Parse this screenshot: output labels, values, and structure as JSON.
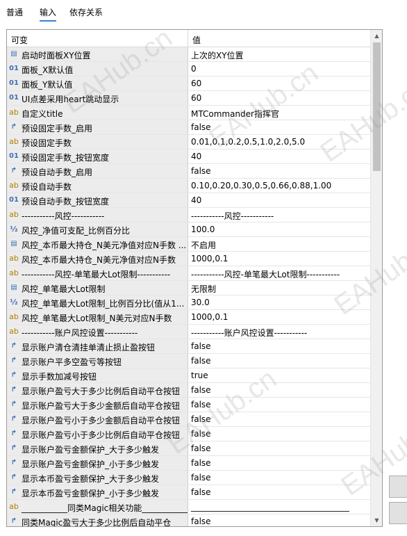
{
  "tabs": [
    {
      "label": "普通"
    },
    {
      "label": "输入"
    },
    {
      "label": "依存关系"
    }
  ],
  "table": {
    "col_variable": "可变",
    "col_value": "值",
    "rows": [
      {
        "icon": "▤",
        "name": "启动时面板XY位置",
        "value": "上次的XY位置"
      },
      {
        "icon": "01",
        "name": "面板_X默认值",
        "value": "0"
      },
      {
        "icon": "01",
        "name": "面板_Y默认值",
        "value": "60"
      },
      {
        "icon": "01",
        "name": "UI点差采用heart跳动显示",
        "value": "60"
      },
      {
        "icon": "ab",
        "name": "自定义title",
        "value": "MTCommander指挥官"
      },
      {
        "icon": "↱",
        "name": "预设固定手数_启用",
        "value": "false"
      },
      {
        "icon": "ab",
        "name": "预设固定手数",
        "value": "0.01,0.1,0.2,0.5,1.0,2.0,5.0"
      },
      {
        "icon": "01",
        "name": "预设固定手数_按钮宽度",
        "value": "40"
      },
      {
        "icon": "↱",
        "name": "预设自动手数_启用",
        "value": "false"
      },
      {
        "icon": "ab",
        "name": "预设自动手数",
        "value": "0.10,0.20,0.30,0.5,0.66,0.88,1.00"
      },
      {
        "icon": "01",
        "name": "预设自动手数_按钮宽度",
        "value": "40"
      },
      {
        "icon": "ab",
        "name": "-----------风控-----------",
        "value": "-----------风控-----------"
      },
      {
        "icon": "½",
        "name": "风控_净值可支配_比例百分比",
        "value": "100.0"
      },
      {
        "icon": "▤",
        "name": "风控_本币最大持仓_N美元净值对应N手数 ...",
        "value": "不启用"
      },
      {
        "icon": "ab",
        "name": "风控_本币最大持仓_N美元净值对应N手数",
        "value": "1000,0.1"
      },
      {
        "icon": "ab",
        "name": "-----------风控-单笔最大Lot限制-----------",
        "value": "-----------风控-单笔最大Lot限制-----------"
      },
      {
        "icon": "▤",
        "name": "风控_单笔最大Lot限制",
        "value": "无限制"
      },
      {
        "icon": "½",
        "name": "风控_单笔最大Lot限制_比例百分比(值从1...",
        "value": "30.0"
      },
      {
        "icon": "ab",
        "name": "风控_单笔最大Lot限制_N美元对应N手数",
        "value": "1000,0.1"
      },
      {
        "icon": "ab",
        "name": "-----------账户风控设置-----------",
        "value": "-----------账户风控设置-----------"
      },
      {
        "icon": "↱",
        "name": "显示账户清仓清挂单清止损止盈按钮",
        "value": "false"
      },
      {
        "icon": "↱",
        "name": "显示账户平多空盈亏等按钮",
        "value": "false"
      },
      {
        "icon": "↱",
        "name": "显示手数加减号按钮",
        "value": "true"
      },
      {
        "icon": "↱",
        "name": "显示账户盈亏大于多少比例后自动平仓按钮",
        "value": "false"
      },
      {
        "icon": "↱",
        "name": "显示账户盈亏大于多少金额后自动平仓按钮",
        "value": "false"
      },
      {
        "icon": "↱",
        "name": "显示账户盈亏小于多少金额后自动平仓按钮",
        "value": "false"
      },
      {
        "icon": "↱",
        "name": "显示账户盈亏小于多少比例后自动平仓按钮",
        "value": "false"
      },
      {
        "icon": "↱",
        "name": "显示账户盈亏金额保护_大于多少触发",
        "value": "false"
      },
      {
        "icon": "↱",
        "name": "显示账户盈亏金额保护_小于多少触发",
        "value": "false"
      },
      {
        "icon": "↱",
        "name": "显示本币盈亏金额保护_大于多少触发",
        "value": "false"
      },
      {
        "icon": "↱",
        "name": "显示本币盈亏金额保护_小于多少触发",
        "value": "false"
      },
      {
        "icon": "ab",
        "name": "___________同类Magic相关功能___________",
        "value": "______________________________________"
      },
      {
        "icon": "↱",
        "name": "同类Magic盈亏大于多少比例后自动平仓",
        "value": "false"
      }
    ]
  },
  "watermark": "EAHub.cn",
  "colors": {
    "accent": "#3c7fd0",
    "name_cell_bg": "#ececec",
    "icon_blue": "#3f6fb5",
    "icon_ab": "#b07d00"
  }
}
